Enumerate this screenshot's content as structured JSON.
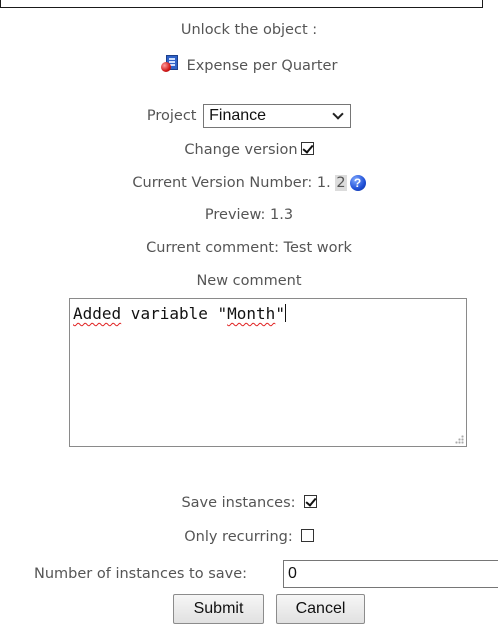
{
  "header": {
    "unlock_label": "Unlock the object :",
    "object_name": "Expense per Quarter",
    "object_icon": "report-document-icon"
  },
  "project": {
    "label": "Project",
    "selected": "Finance"
  },
  "change_version": {
    "label": "Change version",
    "checked": true
  },
  "version": {
    "label": "Current Version Number: 1.",
    "minor": "2",
    "help_icon": "question-icon"
  },
  "preview": {
    "text": "Preview: 1.3"
  },
  "current_comment": {
    "text": "Current comment: Test work"
  },
  "new_comment": {
    "label": "New comment",
    "word1": "Added",
    "middle": " variable \"",
    "word2": "Month",
    "end": "\""
  },
  "save_instances": {
    "label": "Save instances:",
    "checked": true
  },
  "only_recurring": {
    "label": "Only recurring:",
    "checked": false
  },
  "instances_to_save": {
    "label": "Number of instances to save:",
    "value": "0"
  },
  "buttons": {
    "submit": "Submit",
    "cancel": "Cancel"
  }
}
